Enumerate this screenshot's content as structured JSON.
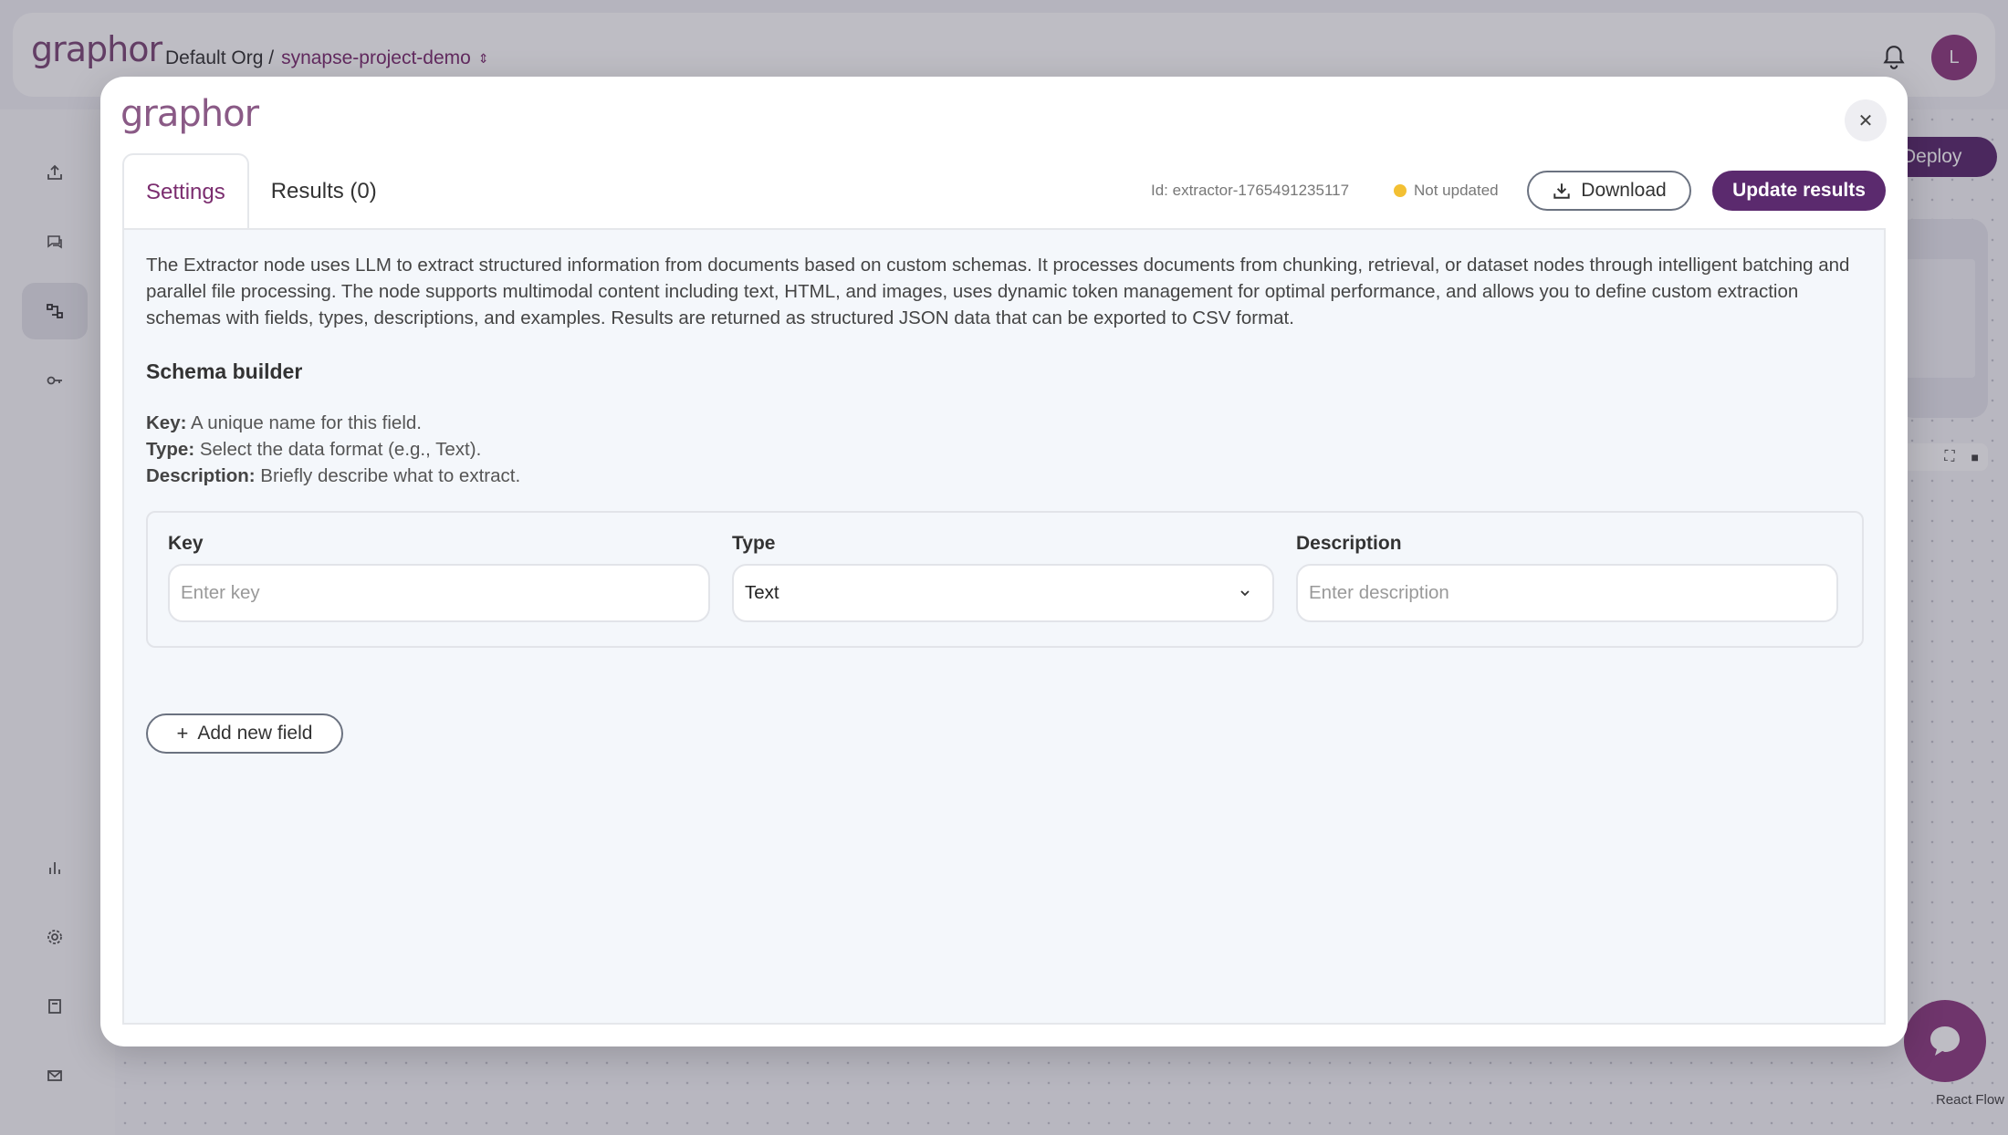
{
  "app": {
    "logo": "graphor",
    "breadcrumb": {
      "org": "Default Org /",
      "project": "synapse-project-demo"
    },
    "avatar_initial": "L",
    "deploy_label": "Deploy",
    "react_flow_label": "React Flow",
    "sidebar_icons": [
      "upload-icon",
      "chat-icon",
      "flow-icon",
      "key-icon",
      "chart-icon",
      "gear-icon",
      "book-icon",
      "mail-icon"
    ]
  },
  "modal": {
    "logo": "graphor",
    "tabs": {
      "settings": "Settings",
      "results": "Results (0)"
    },
    "id_text": "Id: extractor-1765491235117",
    "status_text": "Not updated",
    "download_label": "Download",
    "update_label": "Update results",
    "description": "The Extractor node uses LLM to extract structured information from documents based on custom schemas. It processes documents from chunking, retrieval, or dataset nodes through intelligent batching and parallel file processing. The node supports multimodal content including text, HTML, and images, uses dynamic token management for optimal performance, and allows you to define custom extraction schemas with fields, types, descriptions, and examples. Results are returned as structured JSON data that can be exported to CSV format.",
    "schema_title": "Schema builder",
    "help": {
      "key_label": "Key:",
      "key_text": " A unique name for this field.",
      "type_label": "Type:",
      "type_text": " Select the data format (e.g., Text).",
      "desc_label": "Description:",
      "desc_text": " Briefly describe what to extract."
    },
    "fields": {
      "key_label": "Key",
      "key_placeholder": "Enter key",
      "type_label": "Type",
      "type_value": "Text",
      "desc_label": "Description",
      "desc_placeholder": "Enter description"
    },
    "add_field_label": "Add new field"
  },
  "colors": {
    "brand": "#5b2a6e",
    "accent": "#7b2d6f",
    "status_dot": "#f3c033"
  }
}
